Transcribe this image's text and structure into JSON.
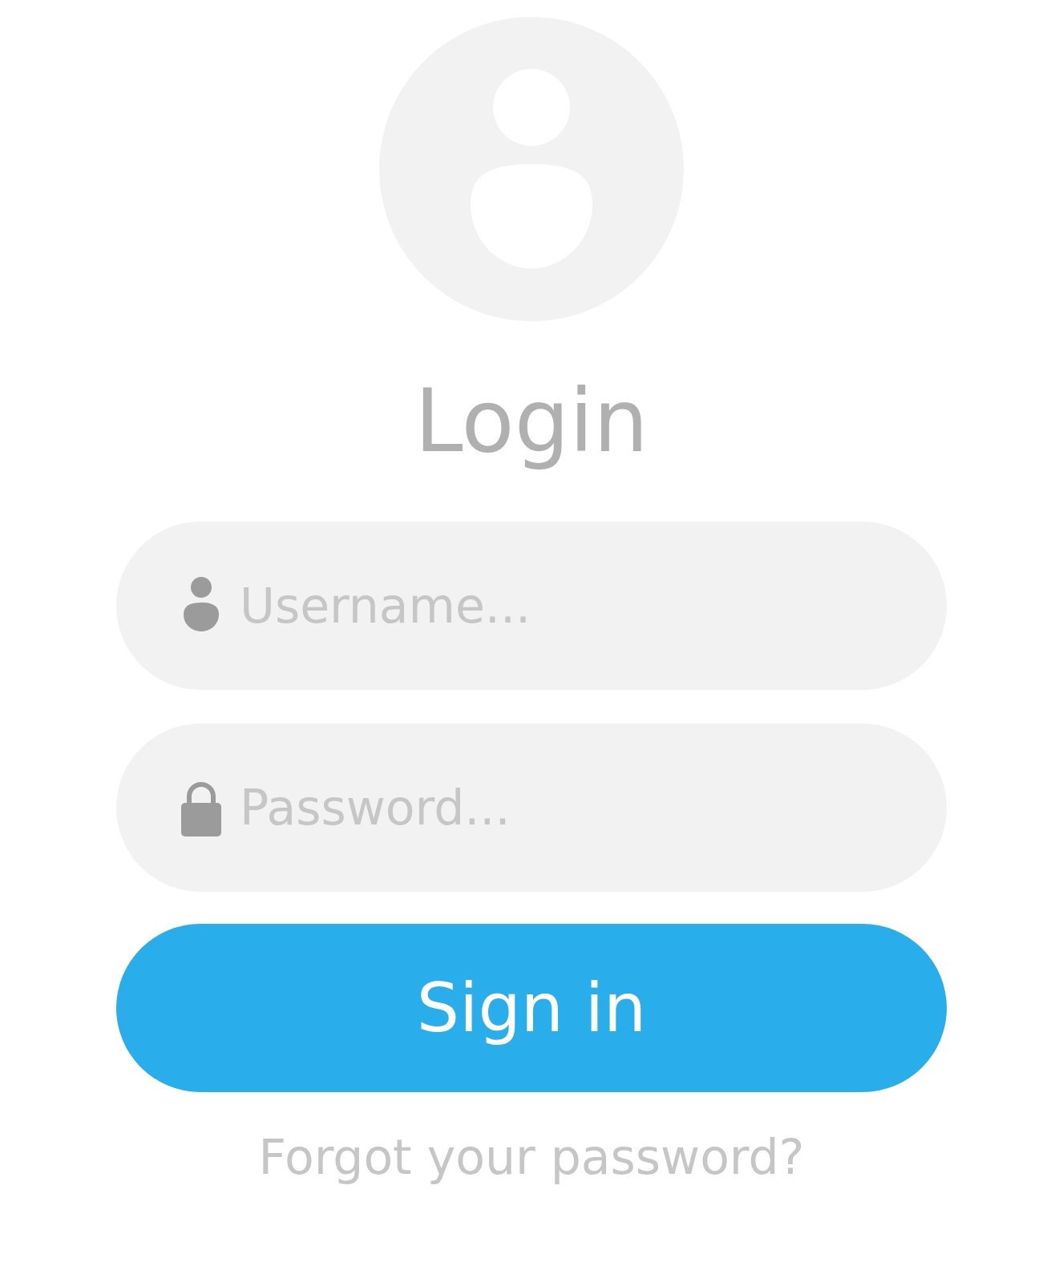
{
  "title": "Login",
  "fields": [
    {
      "kind": "username",
      "placeholder": "Username..."
    },
    {
      "kind": "password",
      "placeholder": "Password..."
    }
  ],
  "button": "Sign in",
  "link": "Forgot your password?"
}
